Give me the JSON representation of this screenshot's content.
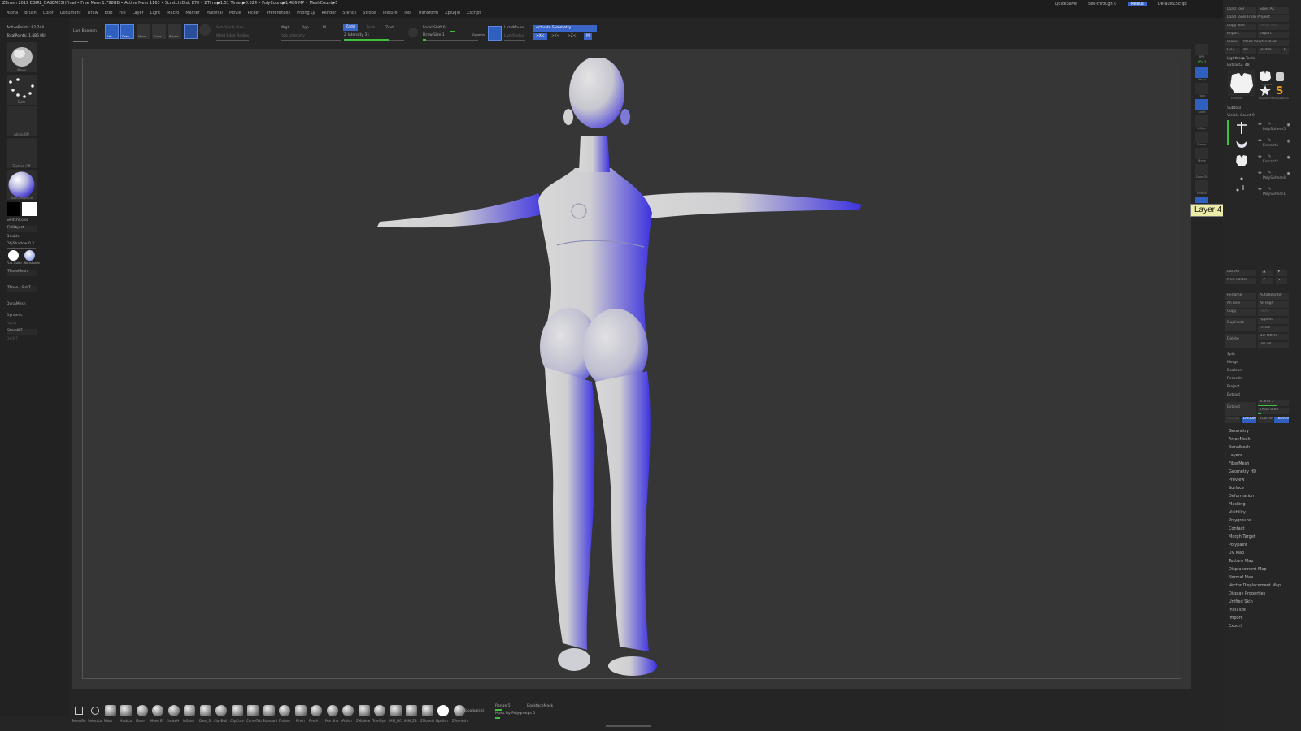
{
  "titlebar": {
    "text": "ZBrush 2019   EGIRL_BASEMESHFinal   • Free Mem 1.798GB • Active Mem 1163 • Scratch Disk 870 • ZTime▶1.51 Timer▶0.024 • PolyCount▶1.486 MP • MeshCount▶5",
    "quicksave": "QuickSave",
    "seethrough": "See-through  0",
    "menus_label": "Menus",
    "default_script": "DefaultZScript"
  },
  "menus": [
    "Alpha",
    "Brush",
    "Color",
    "Document",
    "Draw",
    "Edit",
    "File",
    "Layer",
    "Light",
    "Macro",
    "Marker",
    "Material",
    "Movie",
    "Picker",
    "Preferences",
    "Phong Ly",
    "Render",
    "Stencil",
    "Stroke",
    "Texture",
    "Tool",
    "Transform",
    "Zplugin",
    "Zscript"
  ],
  "shelf": {
    "live_boolean": "Live Boolean",
    "edit": "Edit",
    "draw": "Draw",
    "move": "Move",
    "scale": "Scale",
    "rotate": "Rotate",
    "mrgb": "Mrgb",
    "rgb": "Rgb",
    "m": "M",
    "zadd": "Zadd",
    "zsub": "Zsub",
    "zcut": "Zcut",
    "rgb_intensity": "Rgb Intensity",
    "z_intensity": "Z Intensity 31",
    "focal_shift": "Focal Shift 0",
    "draw_size": "Draw Size 1",
    "dynamic": "Dynamic",
    "lazy_mouse": "LazyMouse",
    "lazy_radius": "LazyRadius",
    "activate_symmetry": "Activate Symmetry",
    "sym_x": ">X<",
    "sym_y": ">Y<",
    "sym_z": ">Z<",
    "sym_m": "M",
    "subdiv": "SubDivide Size",
    "weld": "Weld Edge Radius"
  },
  "left": {
    "active_points": "ActivePoints: 82,744",
    "total_points": "TotalPoints: 1.486 Mil",
    "brush_cap": "Move",
    "stroke_cap": "Dots",
    "alpha_cap": "Alpha Off",
    "texture_cap": "Texture Off",
    "material_cap": "BasicMaterial",
    "switch_color": "SwitchColor",
    "fill_object": "FillObject",
    "double": "Double",
    "obj_shadow": "ObjShadow  0.3",
    "flat_color": "Flat Color  Skinshade",
    "tpose_mesh": "TPoseMesh",
    "tpose_subt": "TPose | SubT",
    "dynamesh": "DynaMesh",
    "dynamic": "Dynamic",
    "apply": "Apply",
    "store_mt": "StoreMT",
    "del_mt": "DelMT"
  },
  "viewport": {
    "tooltip": "Layer 4"
  },
  "right_strip": [
    "BPR",
    "SPix 3",
    "Persp",
    "Floor",
    "Local",
    "L.Sym",
    "Frame",
    "Move",
    "Zoom3D",
    "Rotate",
    "Line Fill",
    "PolyF",
    "Transp",
    "Ghost",
    "Solo",
    "Xpose"
  ],
  "right_panel": {
    "top_buttons": [
      "Load Tool",
      "Save As",
      "Load Tools From Project",
      "Copy Tool",
      "Paste Tool",
      "Import",
      "Export",
      "Clone",
      "Make PolyMesh3D",
      "GoZ",
      "All",
      "Visible",
      "R"
    ],
    "lightbox_tools": "Lightbox▶Tools",
    "extract_label": "Extract2. 48",
    "tool_thumbs": [
      "Extract2",
      "Extract2",
      "PolyMesh3D",
      "SimpleBrush"
    ],
    "subtool_header": "Subtool",
    "visible_count": "Visible Count 9",
    "subtools": [
      "PolySphere5",
      "Extract4",
      "Extract2",
      "PolySphere4",
      "PolySphere1"
    ],
    "list_all": "List All",
    "new_folder": "New Folder",
    "ops_left": [
      "Rename",
      "All Low",
      "Copy",
      "Duplicate",
      "Delete"
    ],
    "ops_right": [
      "AutoReorder",
      "All High",
      "Paste",
      "Append",
      "Insert",
      "Del Other",
      "Del All"
    ],
    "ops_plain": [
      "Split",
      "Merge",
      "Boolean",
      "Remesh",
      "Project",
      "Extract"
    ],
    "extract_row": [
      "Extract",
      "S Smt 5",
      "Thick 0.02"
    ],
    "accept_row": [
      "Accept",
      "Double",
      "TCorne",
      "TBorder"
    ],
    "menu_items": [
      "Geometry",
      "ArrayMesh",
      "NanoMesh",
      "Layers",
      "FiberMesh",
      "Geometry HD",
      "Preview",
      "Surface",
      "Deformation",
      "Masking",
      "Visibility",
      "Polygroups",
      "Contact",
      "Morph Target",
      "Polypaint",
      "UV Map",
      "Texture Map",
      "Displacement Map",
      "Normal Map",
      "Vector Displacement Map",
      "Display Properties",
      "Unified Skin",
      "Initialize",
      "Import",
      "Export"
    ]
  },
  "bottom_shelf": {
    "brushes": [
      "SelectRe",
      "SelectLa",
      "Mask",
      "MaskLa",
      "Move",
      "Move El",
      "SnakeH",
      "Inflate",
      "Dam_St",
      "ClayBuil",
      "ClipCurv",
      "CurveTub",
      "Standard",
      "Flatten",
      "Pinch",
      "Pen A",
      "Pen Sha",
      "sPolish",
      "ZModele",
      "TrimDyn",
      "IMM_BCi",
      "IMM_ZB",
      "ZModele",
      "Hpolish",
      "ZRemesh"
    ],
    "topological": "Topological",
    "range": "Range 5",
    "backface_mask": "BackfaceMask",
    "mask_by_polygroups": "Mask By Polygroups 0"
  },
  "colors": {
    "accent_blue": "#2f5fbf",
    "slider_green": "#3ec13e",
    "model_gray": "#d4d4d4",
    "model_shadow": "#3b2ee0"
  }
}
